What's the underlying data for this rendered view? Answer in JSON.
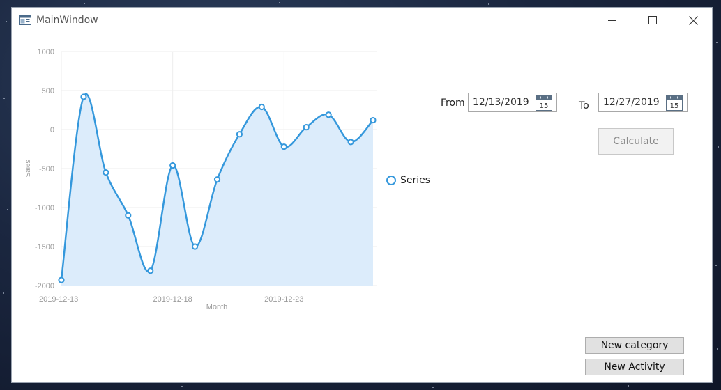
{
  "window": {
    "title": "MainWindow"
  },
  "title_controls": {
    "minimize": "minimize-icon",
    "maximize": "maximize-icon",
    "close": "close-icon"
  },
  "date_range": {
    "from_label": "From",
    "from_value": "12/13/2019",
    "to_label": "To",
    "to_value": "12/27/2019",
    "calendar_icon_day": "15"
  },
  "buttons": {
    "calculate": "Calculate",
    "new_category": "New category",
    "new_activity": "New Activity"
  },
  "legend": {
    "series_name": "Series"
  },
  "colors": {
    "series": "#3598dc",
    "fill": "#dcecfb"
  },
  "chart_data": {
    "type": "area",
    "xlabel": "Month",
    "ylabel": "Sales",
    "ylim": [
      -2000,
      1000
    ],
    "yticks": [
      1000,
      500,
      0,
      -500,
      -1000,
      -1500,
      -2000
    ],
    "xticks": [
      "2019-12-13",
      "2019-12-18",
      "2019-12-23"
    ],
    "grid": true,
    "legend_position": "right",
    "series": [
      {
        "name": "Series",
        "x": [
          "2019-12-13",
          "2019-12-14",
          "2019-12-15",
          "2019-12-16",
          "2019-12-17",
          "2019-12-18",
          "2019-12-19",
          "2019-12-20",
          "2019-12-21",
          "2019-12-22",
          "2019-12-23",
          "2019-12-24",
          "2019-12-25",
          "2019-12-26",
          "2019-12-27"
        ],
        "values": [
          -1930,
          420,
          -550,
          -1100,
          -1810,
          -460,
          -1500,
          -640,
          -60,
          290,
          -220,
          30,
          190,
          -160,
          120
        ]
      }
    ]
  }
}
